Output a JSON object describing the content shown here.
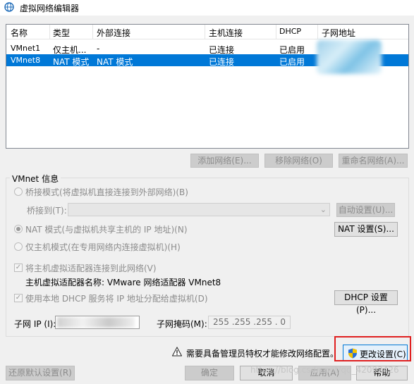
{
  "window": {
    "title": "虚拟网络编辑器"
  },
  "table": {
    "headers": [
      "名称",
      "类型",
      "外部连接",
      "主机连接",
      "DHCP",
      "子网地址"
    ],
    "rows": [
      {
        "name": "VMnet1",
        "type": "仅主机...",
        "external": "-",
        "host": "已连接",
        "dhcp": "已启用",
        "subnet": ""
      },
      {
        "name": "VMnet8",
        "type": "NAT 模式",
        "external": "NAT 模式",
        "host": "已连接",
        "dhcp": "已启用",
        "subnet": ""
      }
    ],
    "selected_index": 1
  },
  "table_buttons": {
    "add": "添加网络(E)...",
    "remove": "移除网络(O)",
    "rename": "重命名网络(A)..."
  },
  "vmnet_info": {
    "group_label": "VMnet 信息",
    "bridge_mode": "桥接模式(将虚拟机直接连接到外部网络)(B)",
    "bridge_to_label": "桥接到(T):",
    "bridge_to_value": "",
    "auto_settings": "自动设置(U)...",
    "nat_mode": "NAT 模式(与虚拟机共享主机的 IP 地址)(N)",
    "nat_settings": "NAT 设置(S)...",
    "host_only": "仅主机模式(在专用网络内连接虚拟机)(H)",
    "connect_adapter": "将主机虚拟适配器连接到此网络(V)",
    "adapter_name": "主机虚拟适配器名称: VMware 网络适配器 VMnet8",
    "use_dhcp": "使用本地 DHCP 服务将 IP 地址分配给虚拟机(D)",
    "dhcp_settings": "DHCP 设置(P)...",
    "subnet_ip_label": "子网 IP (I):",
    "subnet_ip_value": "",
    "subnet_mask_label": "子网掩码(M):",
    "subnet_mask_value": "255 .255 .255 . 0",
    "selected_mode": "nat",
    "connect_adapter_checked": true,
    "use_dhcp_checked": true
  },
  "footer": {
    "admin_notice": "需要具备管理员特权才能修改网络配置。",
    "change_settings": "更改设置(C)",
    "restore_defaults": "还原默认设置(R)",
    "ok": "确定",
    "cancel": "取消",
    "apply": "应用(A)",
    "help": "帮助",
    "watermark": "https://blog.csdn.net/qq_42092426"
  },
  "colors": {
    "selection": "#0078d7",
    "highlight_frame": "#e02020",
    "warning": "#f5c400"
  }
}
